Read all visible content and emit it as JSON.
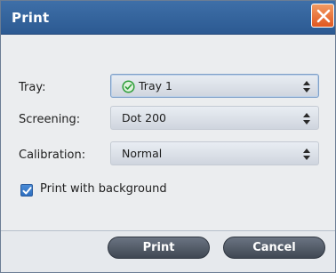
{
  "window": {
    "title": "Print"
  },
  "fields": {
    "tray": {
      "label": "Tray:",
      "value": "Tray 1",
      "status_icon": "check-circle-icon"
    },
    "screening": {
      "label": "Screening:",
      "value": "Dot 200"
    },
    "calibration": {
      "label": "Calibration:",
      "value": "Normal"
    }
  },
  "options": {
    "print_with_background": {
      "label": "Print with background",
      "checked": true
    }
  },
  "buttons": {
    "print": "Print",
    "cancel": "Cancel"
  },
  "colors": {
    "titlebar": "#3e6fa8",
    "close_button": "#e1571f",
    "button": "#4f5864",
    "checkbox": "#3a7ccc",
    "tray_status": "#2e9e3a"
  }
}
